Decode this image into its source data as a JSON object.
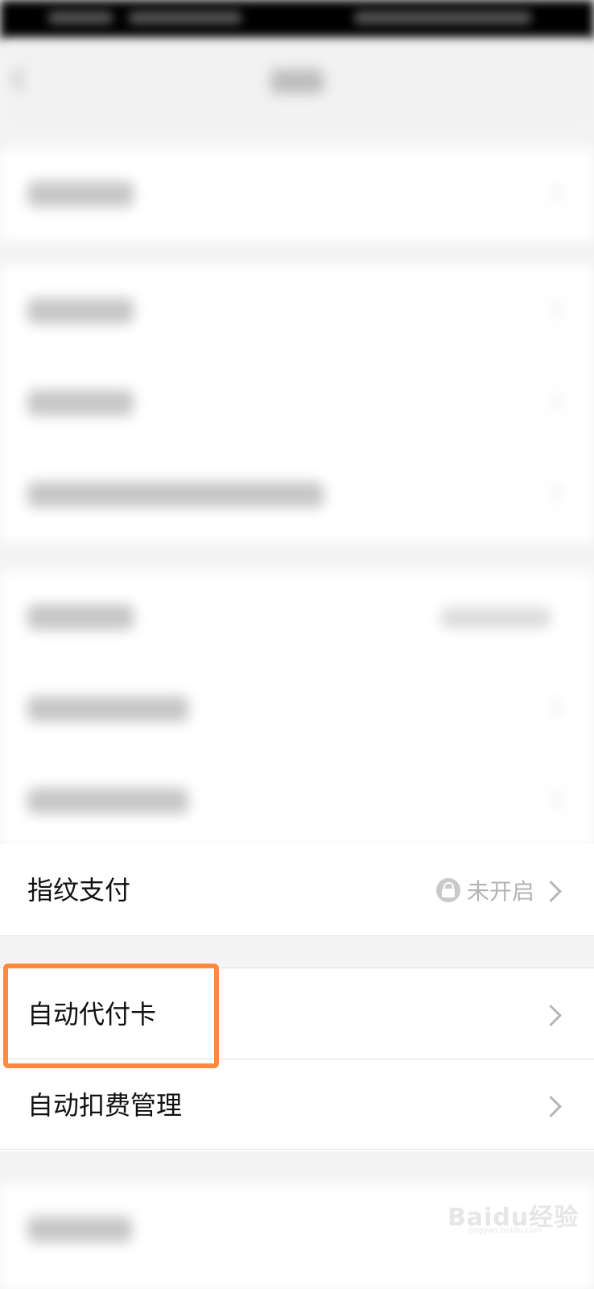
{
  "rows": {
    "fingerprint_pay": {
      "label": "指纹支付",
      "status": "未开启"
    },
    "auto_pay_card": {
      "label": "自动代付卡"
    },
    "auto_deduct": {
      "label": "自动扣费管理"
    }
  },
  "watermark": {
    "brand": "Baidu经验",
    "url": "jingyan.baidu.com"
  },
  "colors": {
    "highlight": "#ff8a3d",
    "background": "#f4f4f4"
  }
}
